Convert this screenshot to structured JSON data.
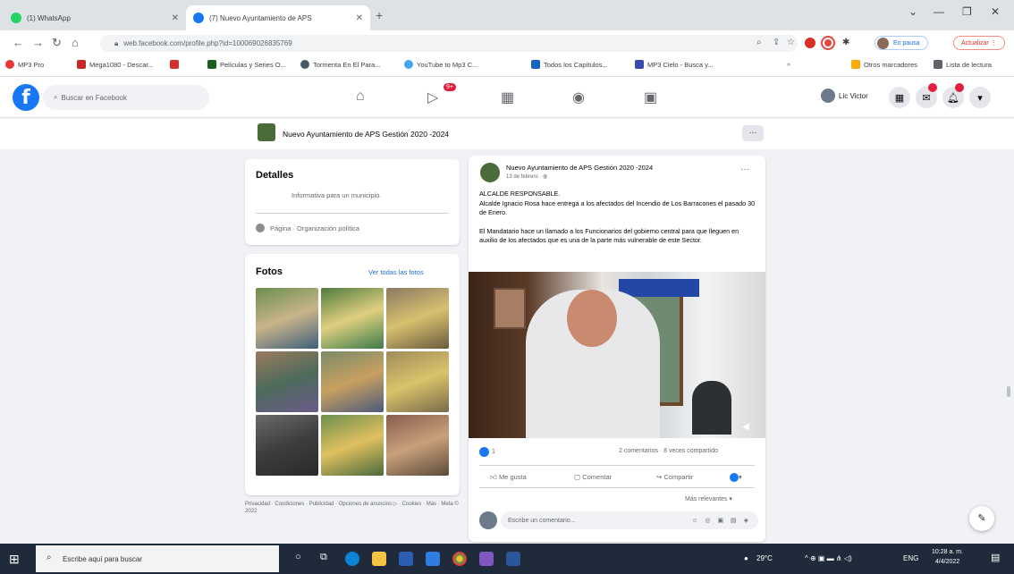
{
  "browser": {
    "tabs": [
      {
        "title": "(1) WhatsApp",
        "active": false
      },
      {
        "title": "(7) Nuevo Ayuntamiento de APS",
        "active": true
      }
    ],
    "url": "web.facebook.com/profile.php?id=100069026835769",
    "profile_label": "En pausa",
    "update_label": "Actualizar",
    "bookmarks": [
      "MP3 Pro",
      "Mega1080 - Descar...",
      "Películas y Series O...",
      "Tormenta En El Para...",
      "YouTube to Mp3 C...",
      "Todos los Capítulos...",
      "MP3 Cielo - Busca y..."
    ],
    "bookmarks_right": [
      "Otros marcadores",
      "Lista de lectura"
    ]
  },
  "facebook": {
    "search_placeholder": "Buscar en Facebook",
    "watch_badge": "9+",
    "user_name": "Lic Victor"
  },
  "page": {
    "title": "Nuevo Ayuntamiento de APS Gestión 2020 -2024",
    "more_label": "···"
  },
  "details": {
    "heading": "Detalles",
    "description": "Informativa para un municipio.",
    "category": "Página · Organización política"
  },
  "photos": {
    "heading": "Fotos",
    "see_all": "Ver todas las fotos"
  },
  "footer": "Privacidad · Condiciones · Publicidad · Opciones de anuncios ▷ · Cookies · Más · Meta © 2022",
  "post": {
    "author": "Nuevo Ayuntamiento de APS Gestión 2020 -2024",
    "date": "13 de febrero · ◍",
    "line1": "ALCALDE RESPONSABLE.",
    "line2": "Alcalde Ignacio Rosa hace entrega a los afectados del Incendio de Los Barracones el pasado 30 de Enero.",
    "line3": "El Mandatario hace un llamado a los Funcionarios del gobierno central para que lleguen en auxilio de los afectados que es una de la parte más vulnerable de este Sector.",
    "reactions": "1",
    "comments_shares": "2 comentarios · 8 veces compartido",
    "like": "Me gusta",
    "comment": "Comentar",
    "share": "Compartir",
    "relevance": "Más relevantes ▾",
    "comment_placeholder": "Escribe un comentario..."
  },
  "taskbar": {
    "search_placeholder": "Escribe aquí para buscar",
    "temperature": "29°C",
    "lang": "ENG",
    "time": "10:28 a. m.",
    "date": "4/4/2022"
  }
}
